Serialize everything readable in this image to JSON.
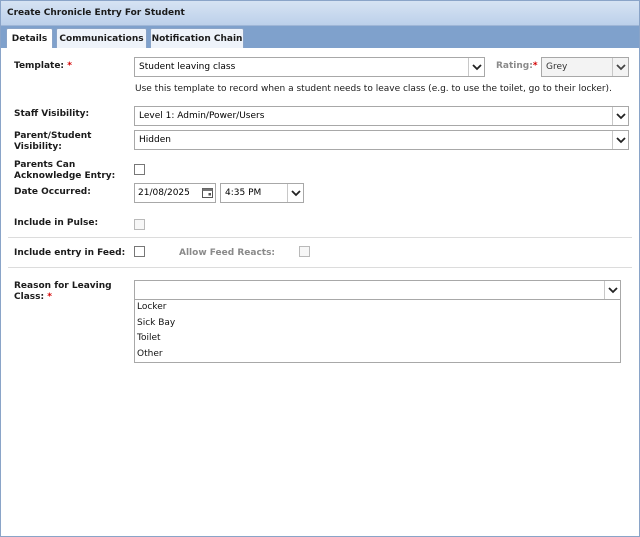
{
  "window": {
    "title": "Create Chronicle Entry For Student"
  },
  "tabs": [
    {
      "label": "Details",
      "active": true
    },
    {
      "label": "Communications",
      "active": false
    },
    {
      "label": "Notification Chain",
      "active": false
    }
  ],
  "form": {
    "template": {
      "label": "Template:",
      "required_mark": "*",
      "value": "Student leaving class",
      "help": "Use this template to record when a student needs to leave class (e.g. to use the toilet, go to their locker)."
    },
    "rating": {
      "label": "Rating:",
      "required_mark": "*",
      "value": "Grey"
    },
    "staff_visibility": {
      "label": "Staff Visibility:",
      "value": "Level 1: Admin/Power/Users"
    },
    "parent_student_visibility": {
      "label_line1": "Parent/Student",
      "label_line2": "Visibility:",
      "value": "Hidden"
    },
    "parents_can_acknowledge": {
      "label_line1": "Parents Can",
      "label_line2": "Acknowledge Entry:",
      "checked": false
    },
    "date_occurred": {
      "label": "Date Occurred:",
      "date": "21/08/2025",
      "time": "4:35 PM"
    },
    "include_in_pulse": {
      "label": "Include in Pulse:",
      "checked": false,
      "disabled": true
    },
    "include_in_feed": {
      "label": "Include entry in Feed:",
      "checked": false
    },
    "allow_feed_reacts": {
      "label": "Allow Feed Reacts:",
      "checked": false,
      "disabled": true
    },
    "reason": {
      "label_line1": "Reason for Leaving",
      "label_line2": "Class:",
      "required_mark": "*",
      "value": "",
      "options": [
        "Locker",
        "Sick Bay",
        "Toilet",
        "Other"
      ]
    }
  },
  "icons": {
    "dropdown": "chevron-down-icon",
    "calendar": "calendar-icon"
  },
  "colors": {
    "titlebar": "#bcd0ea",
    "tabstrip": "#7fa1cc",
    "required": "#d40000"
  }
}
